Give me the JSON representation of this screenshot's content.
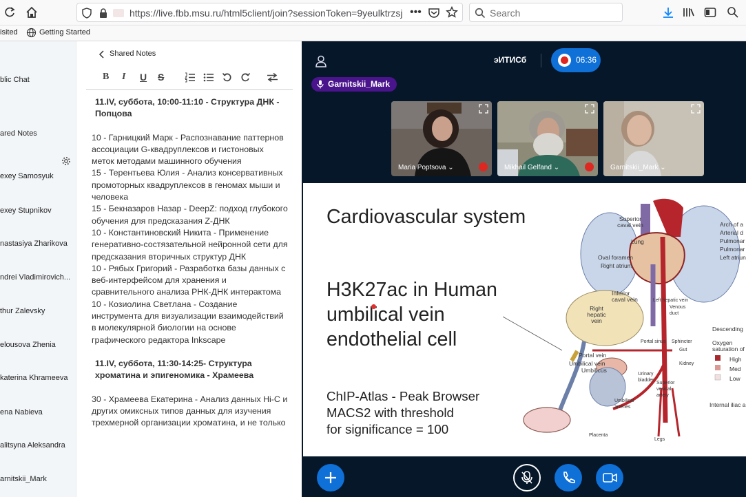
{
  "browser": {
    "url": "https://live.fbb.msu.ru/html5client/join?sessionToken=9yeulktrzsj",
    "search_placeholder": "Search",
    "bookmarks": {
      "visited": "isited",
      "getting_started": "Getting Started"
    }
  },
  "userlist": {
    "public_chat": "blic Chat",
    "shared_notes": "ared Notes",
    "users": [
      "exey Samosyuk",
      "exey Stupnikov",
      "nastasiya Zharikova",
      "ndrei Vladimirovich...",
      "thur Zalevsky",
      "elousova Zhenia",
      "katerina Khrameeva",
      "ena Nabieva",
      "alitsyna Aleksandra",
      "arnitskii_Mark"
    ]
  },
  "notes": {
    "header": "Shared Notes",
    "tools": [
      "B",
      "I",
      "U",
      "S"
    ],
    "body": [
      {
        "type": "h",
        "text": "11.IV, суббота, 10:00-11:10 - Структура ДНК - Попцова"
      },
      {
        "type": "p",
        "text": "10 - Гарницкий Марк - Распознавание паттернов ассоциации G-квадруплексов и гистоновых меток методами машинного обучения\n15 - Терентьева Юлия - Анализ консервативных промоторных квадруплексов в геномах мыши и человека\n15 - Бекназаров Назар - DeepZ: подход глубокого обучения для предсказания Z-ДНК\n10 - Константиновский Никита - Применение генеративно-состязательной нейронной сети для предсказания вторичных структур ДНК\n10 - Рябых Григорий - Разработка базы данных с веб-интерфейсом для хранения и сравнительного анализа РНК-ДНК интерактома\n10 - Козиолина Светлана - Создание инструмента для визуализации взаимодействий в молекулярной биологии на основе графического редактора Inkscape"
      },
      {
        "type": "h",
        "text": "11.IV, суббота, 11:30-14:25- Структура хроматина и эпигеномика - Храмеева"
      },
      {
        "type": "p",
        "text": "30 - Храмеева Екатерина - Анализ данных Hi-C и других омиксных типов данных для изучения трехмерной организации хроматина, и не только"
      }
    ]
  },
  "meeting": {
    "title": "эИТИСб",
    "timer": "06:36",
    "talker": "Garnitskii_Mark",
    "videos": [
      {
        "name": "Maria Poptsova ⌄",
        "bg": "#5a5450"
      },
      {
        "name": "Mikhail Gelfand ⌄",
        "bg": "#6f6a5a"
      },
      {
        "name": "Garnitskii_Mark ⌄",
        "bg": "#9a9388"
      }
    ]
  },
  "slide": {
    "title": "Cardiovascular system",
    "subtitle_lines": [
      "H3K27ac in Human",
      "umbilical vein",
      "endothelial cell"
    ],
    "info_lines": [
      "ChIP-Atlas - Peak Browser",
      "MACS2 with threshold",
      "for significance = 100"
    ],
    "diagram_labels": {
      "superior_caval_vein": "Superior caval vein",
      "lung": "Lung",
      "oval_foramen": "Oval foramen",
      "right_atrium": "Right atrium",
      "inferior_caval_vein": "Inferior caval vein",
      "right_hepatic_vein": "Right hepatic vein",
      "left_hepatic_vein": "Left hepatic vein",
      "venous_duct": "Venous duct",
      "portal_sinus": "Portal sinus",
      "sphincter": "Sphincter",
      "gut": "Gut",
      "kidney": "Kidney",
      "portal_vein": "Portal vein",
      "umbilical_vein": "Umbilical vein",
      "umbilicus": "Umbilicus",
      "urinary_bladder": "Urinary bladder",
      "umbilical_arteries": "Umbilical arteries",
      "superior_vesical_artery": "Superior vesical artery",
      "placenta": "Placenta",
      "legs": "Legs",
      "arch_of_aorta": "Arch of a",
      "arterial_duct": "Arterial d",
      "pulmonary1": "Pulmonar",
      "pulmonary2": "Pulmonar",
      "left_atrium": "Left atriun",
      "descending": "Descending",
      "oxygen": "Oxygen saturation of",
      "high": "High",
      "med": "Med",
      "low": "Low",
      "internal_iliac": "Internal iliac a"
    }
  }
}
